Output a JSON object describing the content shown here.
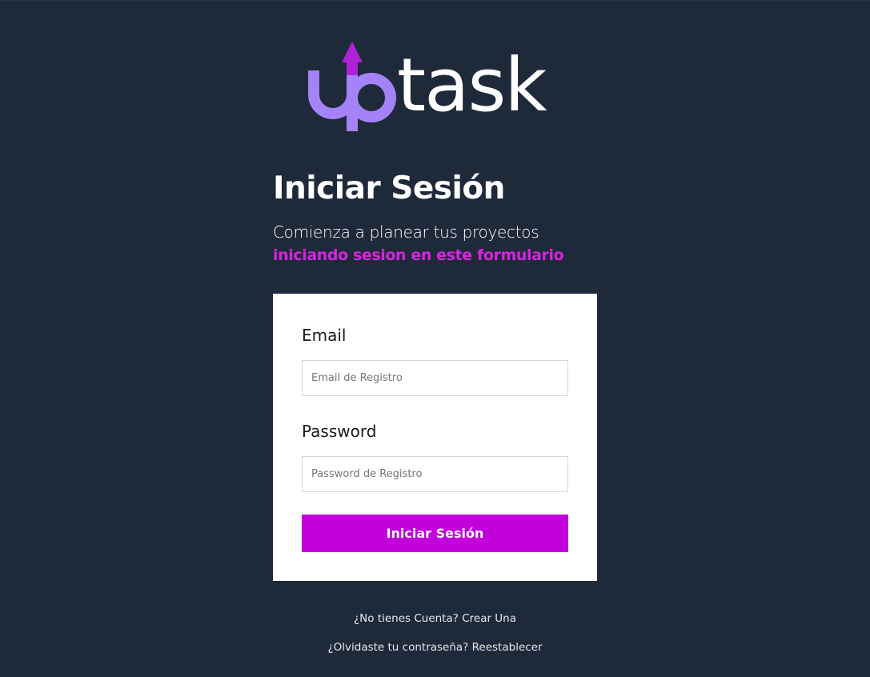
{
  "logo": {
    "text_up": "up",
    "text_task": "task",
    "colors": {
      "up": "#a482f8",
      "arrow": "#b022d8",
      "task": "#ffffff"
    }
  },
  "header": {
    "title": "Iniciar Sesión",
    "subtitle_line1": "Comienza a planear tus proyectos",
    "subtitle_line2": "iniciando sesion en este formulario"
  },
  "form": {
    "email_label": "Email",
    "email_placeholder": "Email de Registro",
    "email_value": "",
    "password_label": "Password",
    "password_placeholder": "Password de Registro",
    "password_value": "",
    "submit_label": "Iniciar Sesión"
  },
  "links": {
    "create_account": "¿No tienes Cuenta? Crear Una",
    "reset_password": "¿Olvidaste tu contraseña? Reestablecer"
  },
  "colors": {
    "background": "#1e2939",
    "accent": "#c300dc",
    "accent_text": "#d426e0",
    "card": "#ffffff"
  }
}
